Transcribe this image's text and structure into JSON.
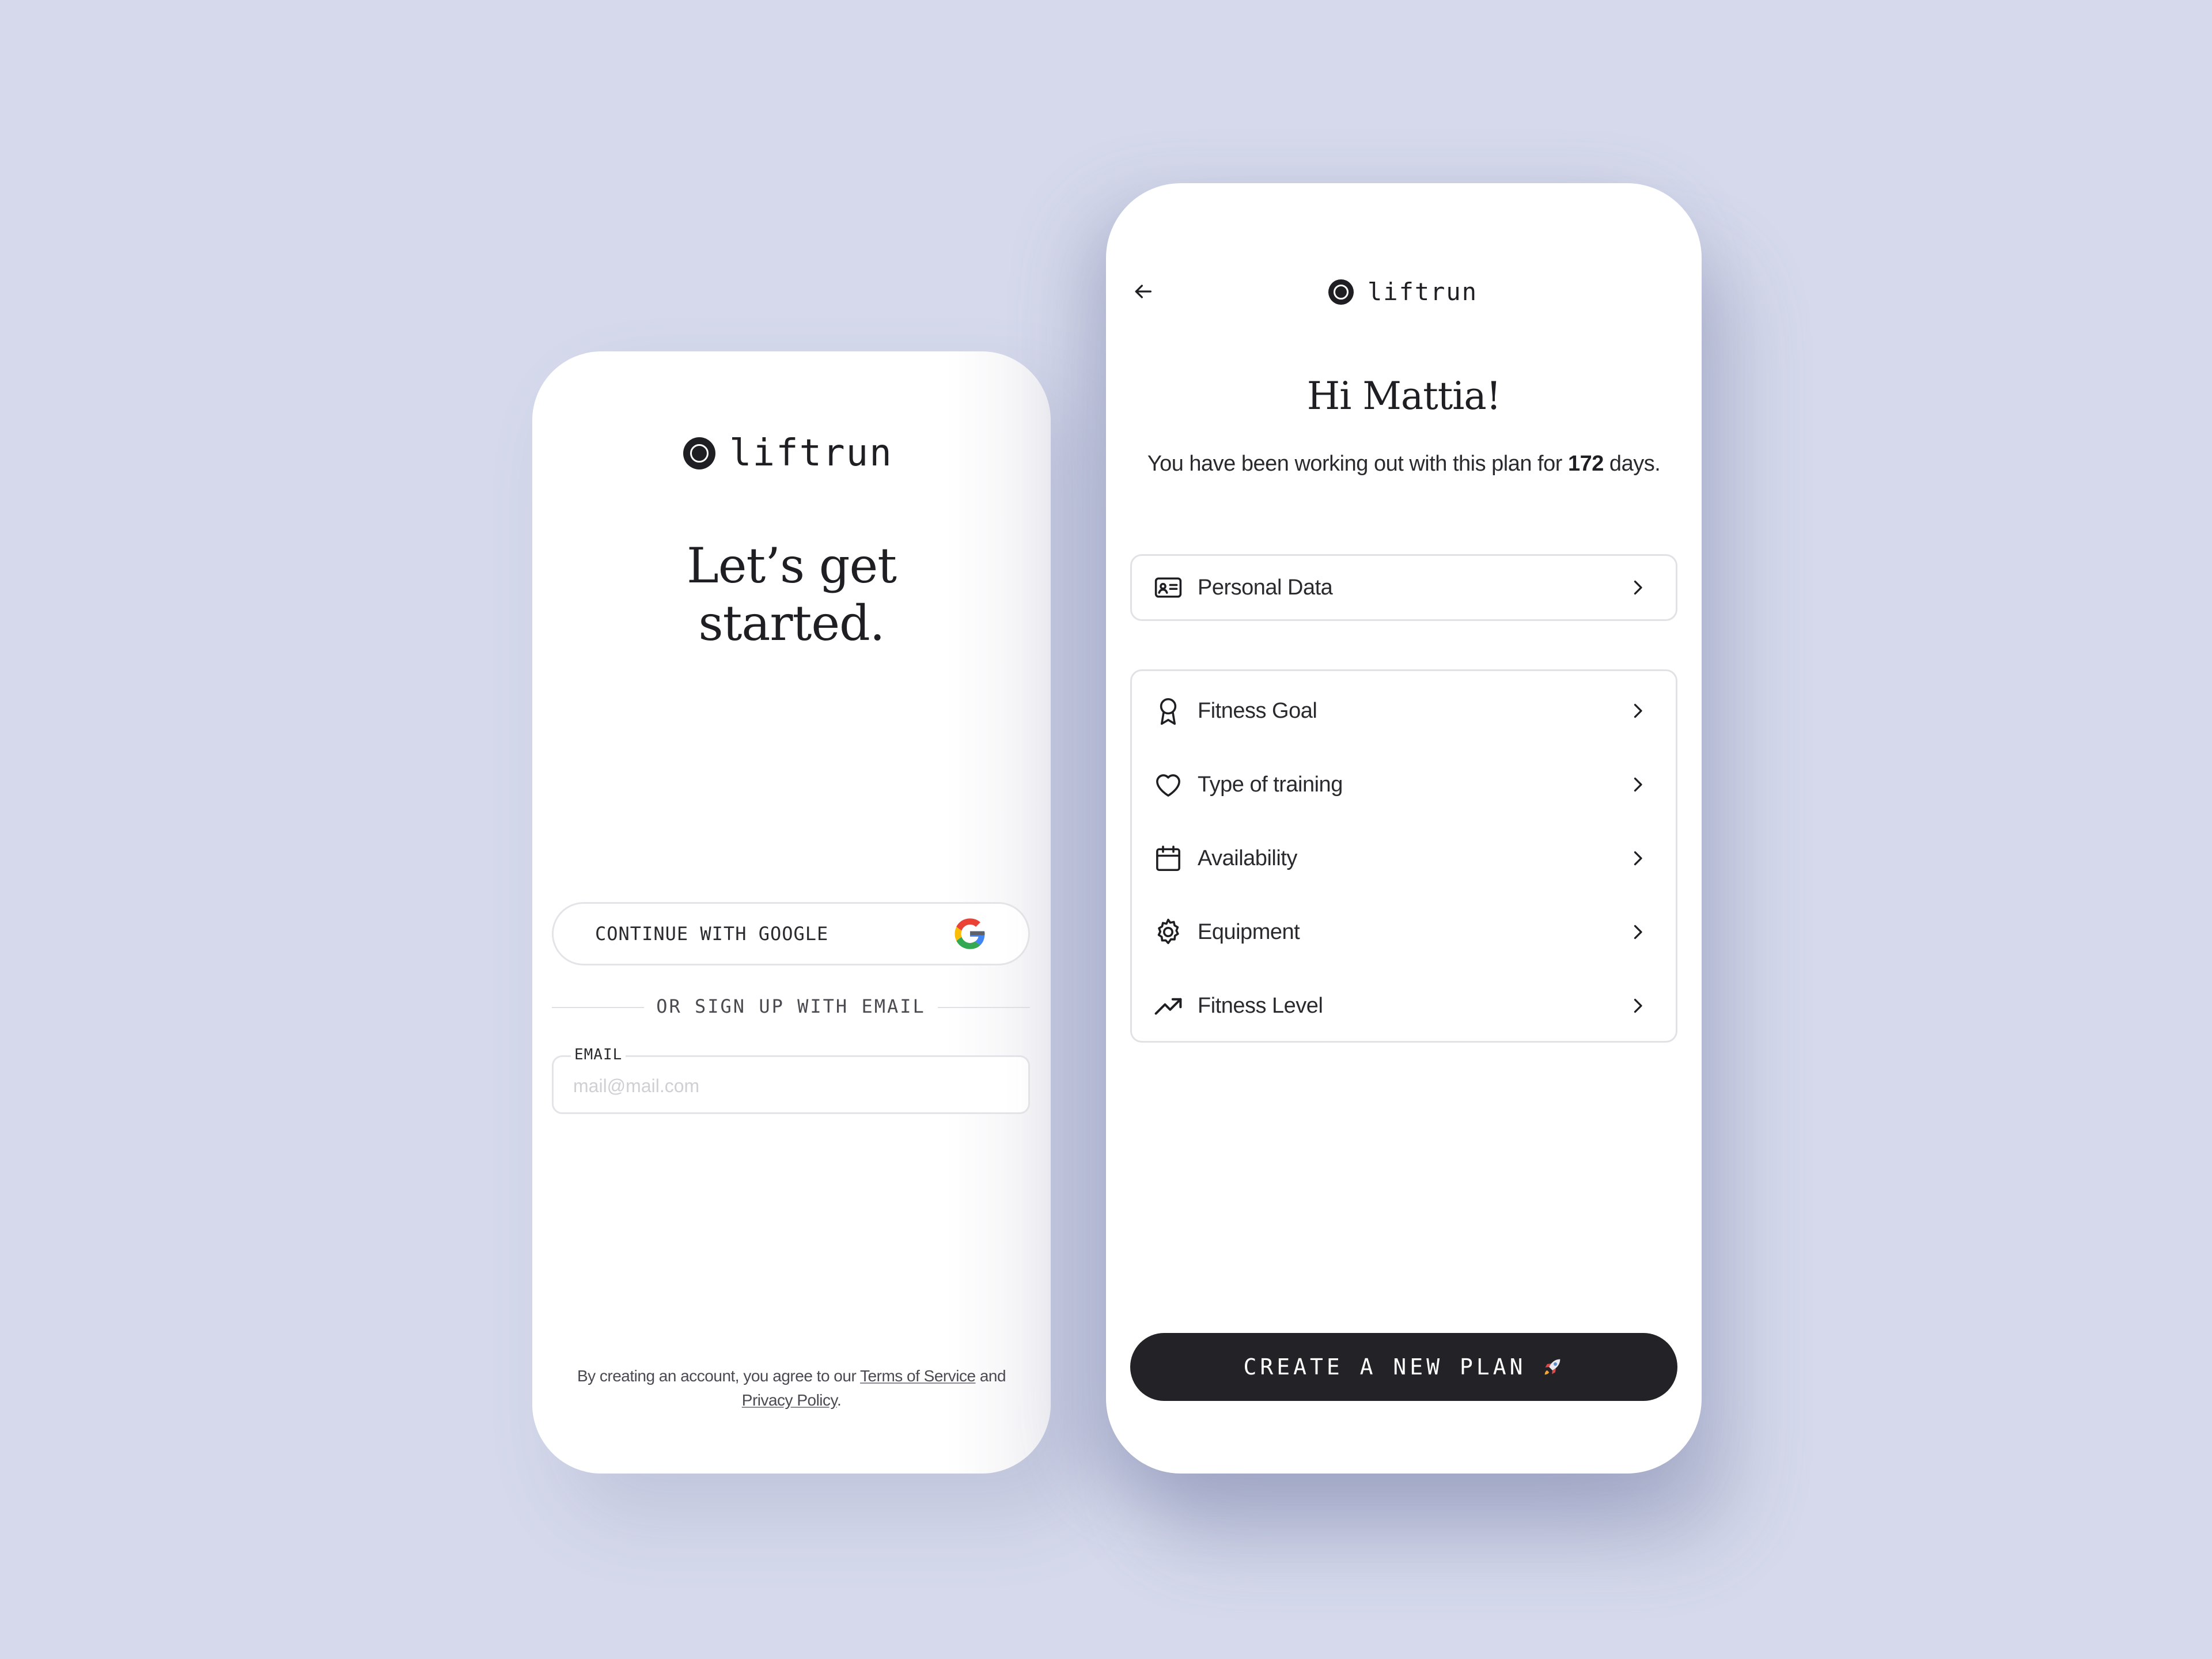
{
  "colors": {
    "background": "#d5d9eb",
    "surface": "#ffffff",
    "ink": "#1f1f23",
    "button_dark": "#232327",
    "border": "#e2e2e6",
    "google_red": "#ea4335",
    "google_yellow": "#fbbc05",
    "google_green": "#34a853",
    "google_blue": "#4285f4"
  },
  "signup": {
    "logo_text": "liftrun",
    "logo_icon": "circle-logo-icon",
    "headline_line1": "Let’s get",
    "headline_line2": "started.",
    "google_button_label": "CONTINUE WITH GOOGLE",
    "google_icon": "google-g-icon",
    "divider_text": "OR SIGN UP WITH EMAIL",
    "email_label": "EMAIL",
    "email_placeholder": "mail@mail.com",
    "email_value": "",
    "legal_prefix": "By creating an account, you agree to our ",
    "terms_link": "Terms of Service",
    "legal_and": " and",
    "privacy_link": "Privacy Policy",
    "legal_suffix": "."
  },
  "profile": {
    "back_icon": "arrow-left-icon",
    "logo_text": "liftrun",
    "greeting": "Hi Mattia!",
    "subtitle_prefix": "You have been working out with this plan for ",
    "days_count": "172",
    "subtitle_suffix": " days.",
    "personal_item": {
      "label": "Personal Data",
      "icon": "id-card-icon"
    },
    "settings_items": [
      {
        "label": "Fitness Goal",
        "icon": "award-icon"
      },
      {
        "label": "Type of training",
        "icon": "heart-icon"
      },
      {
        "label": "Availability",
        "icon": "calendar-icon"
      },
      {
        "label": "Equipment",
        "icon": "gear-icon"
      },
      {
        "label": "Fitness Level",
        "icon": "trending-up-icon"
      }
    ],
    "cta_label": "CREATE A NEW PLAN",
    "cta_icon": "rocket-icon"
  }
}
